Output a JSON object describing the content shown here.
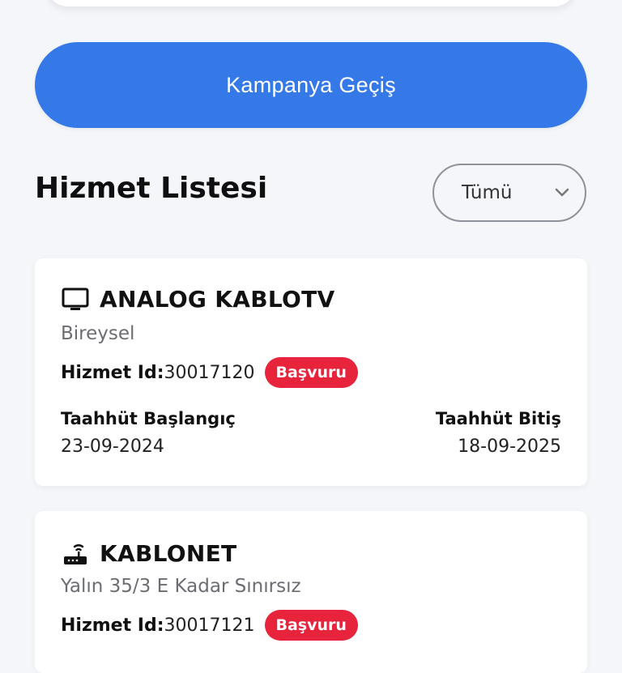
{
  "campaign_button": {
    "label": "Kampanya Geçiş"
  },
  "section": {
    "title": "Hizmet Listesi"
  },
  "filter": {
    "selected": "Tümü",
    "chevron_icon": "chevron-down-icon"
  },
  "services": [
    {
      "icon": "tv-icon",
      "name": "ANALOG KABLOTV",
      "description": "Bireysel",
      "id_label": "Hizmet Id:",
      "id_value": "30017120",
      "status": "Başvuru",
      "start_label": "Taahhüt Başlangıç",
      "start_date": "23-09-2024",
      "end_label": "Taahhüt Bitiş",
      "end_date": "18-09-2025"
    },
    {
      "icon": "router-icon",
      "name": "KABLONET",
      "description": "Yalın 35/3 E Kadar Sınırsız",
      "id_label": "Hizmet Id:",
      "id_value": "30017121",
      "status": "Başvuru"
    }
  ],
  "colors": {
    "accent": "#3479e7",
    "status_badge": "#e8233c",
    "background": "#f4f6fa"
  }
}
